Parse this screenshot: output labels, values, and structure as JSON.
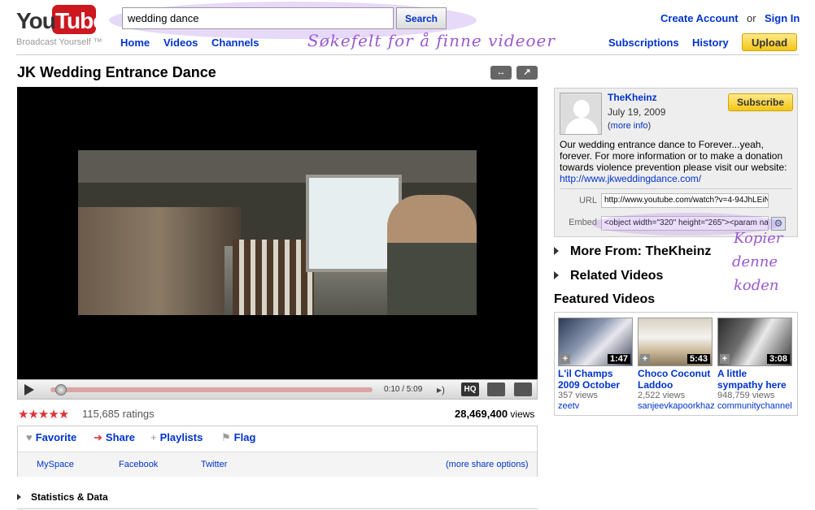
{
  "header": {
    "logo_you": "You",
    "logo_tube": "Tube",
    "tagline": "Broadcast Yourself ™",
    "search_value": "wedding dance",
    "search_button": "Search",
    "nav": [
      "Home",
      "Videos",
      "Channels"
    ],
    "create_account": "Create Account",
    "or": "or",
    "sign_in": "Sign In",
    "user_nav": [
      "Subscriptions",
      "History"
    ],
    "upload": "Upload",
    "annotation": "Søkefelt for å finne videoer"
  },
  "video": {
    "title": "JK Wedding Entrance Dance",
    "expand_label": "↔",
    "popout_label": "↗",
    "time": "0:10 / 5:09",
    "progress_fraction": 0.032,
    "hq": "HQ",
    "stars": "★★★★★",
    "ratings": "115,685 ratings",
    "views_number": "28,469,400",
    "views_label": "views"
  },
  "actions": {
    "favorite": "Favorite",
    "share": "Share",
    "playlists": "Playlists",
    "flag": "Flag",
    "share_targets": [
      "MySpace",
      "Facebook",
      "Twitter"
    ],
    "more_share": "(more share options)",
    "statistics": "Statistics & Data"
  },
  "sidebar": {
    "uploader": "TheKheinz",
    "date": "July 19, 2009",
    "more_info": "more info",
    "subscribe": "Subscribe",
    "description": "Our wedding entrance dance to Forever...yeah, forever. For more information or to make a donation towards violence prevention please visit our website:",
    "website": "http://www.jkweddingdance.com/",
    "url_label": "URL",
    "url_value": "http://www.youtube.com/watch?v=4-94JhLEiN",
    "embed_label": "Embed",
    "embed_value": "<object width=\"320\" height=\"265\"><param na",
    "annotation_copy": [
      "Kopier",
      "denne",
      "koden"
    ],
    "more_from": "More From: TheKheinz",
    "related": "Related Videos",
    "featured": "Featured Videos",
    "featured_videos": [
      {
        "title1": "L'il Champs",
        "title2": "2009 October",
        "duration": "1:47",
        "views": "357 views",
        "user": "zeetv"
      },
      {
        "title1": "Choco Coconut",
        "title2": "Laddoo",
        "duration": "5:43",
        "views": "2,522 views",
        "user": "sanjeevkapoorkhaz"
      },
      {
        "title1": "A little",
        "title2": "sympathy here",
        "duration": "3:08",
        "views": "948,759 views",
        "user": "communitychannel"
      }
    ]
  },
  "colors": {
    "brand_red": "#cc181e",
    "link_blue": "#0033cc",
    "annotation_purple": "#9b59d0",
    "button_yellow": "#f3c617"
  }
}
